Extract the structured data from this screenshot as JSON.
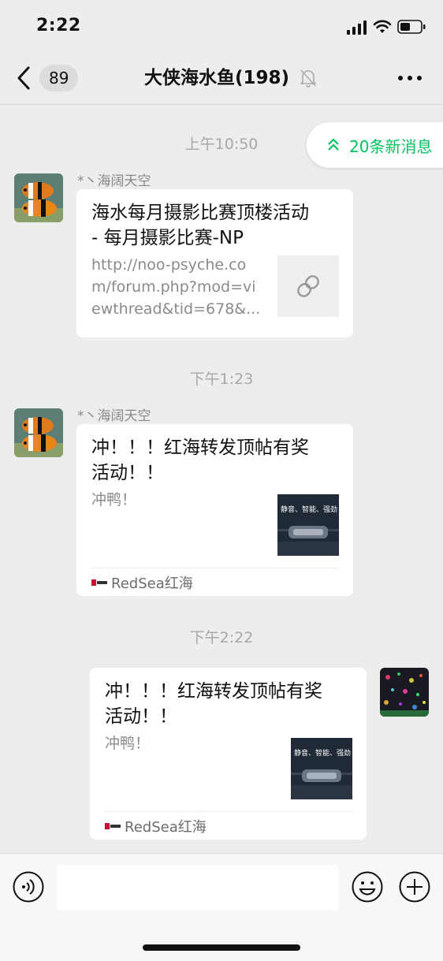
{
  "status_bar": {
    "time": "2:22"
  },
  "nav": {
    "back_count": "89",
    "title": "大侠海水鱼(198)"
  },
  "new_messages": {
    "label": "20条新消息"
  },
  "messages": [
    {
      "time": "上午10:50",
      "sender": "*丶海阔天空",
      "title_line1": "海水每月摄影比赛顶楼活动",
      "title_line2": "- 每月摄影比赛-NP",
      "desc": "http://noo-psyche.com/forum.php?mod=viewthread&tid=678&..."
    },
    {
      "time": "下午1:23",
      "sender": "*丶海阔天空",
      "title_line1": "冲！！！红海转发顶帖有奖",
      "title_line2": "活动！！",
      "desc": "冲鸭！",
      "thumb_text": "静音、智能、强劲",
      "source": "RedSea红海"
    },
    {
      "time": "下午2:22",
      "title_line1": "冲！！！红海转发顶帖有奖",
      "title_line2": "活动！！",
      "desc": "冲鸭！",
      "thumb_text": "静音、智能、强劲",
      "source": "RedSea红海"
    }
  ],
  "input": {
    "placeholder": ""
  },
  "colors": {
    "accent": "#07c160",
    "background": "#ededed"
  }
}
